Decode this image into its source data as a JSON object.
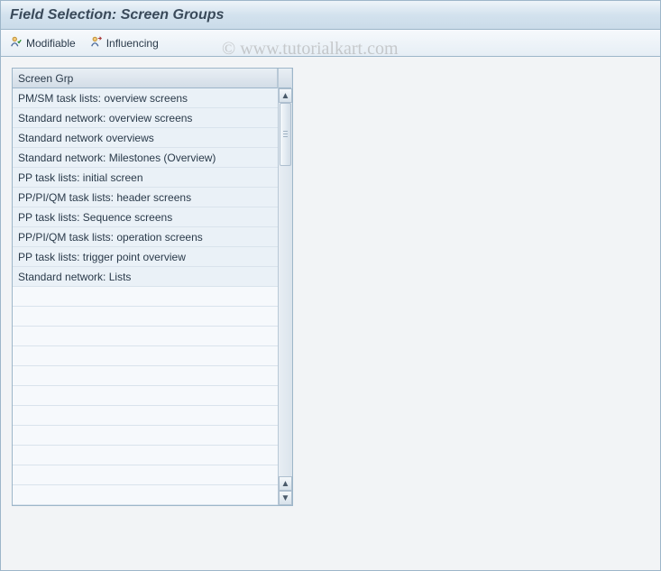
{
  "title": "Field Selection: Screen Groups",
  "toolbar": {
    "modifiable_label": "Modifiable",
    "influencing_label": "Influencing"
  },
  "table": {
    "column_header": "Screen Grp",
    "rows": [
      "PM/SM task lists: overview screens",
      "Standard network: overview screens",
      "Standard network overviews",
      "Standard network: Milestones (Overview)",
      "PP task lists: initial screen",
      "PP/PI/QM task lists: header screens",
      "PP task lists: Sequence screens",
      "PP/PI/QM task lists: operation screens",
      "PP task lists: trigger point overview",
      "Standard network: Lists"
    ],
    "empty_rows": 11
  },
  "watermark": "© www.tutorialkart.com"
}
